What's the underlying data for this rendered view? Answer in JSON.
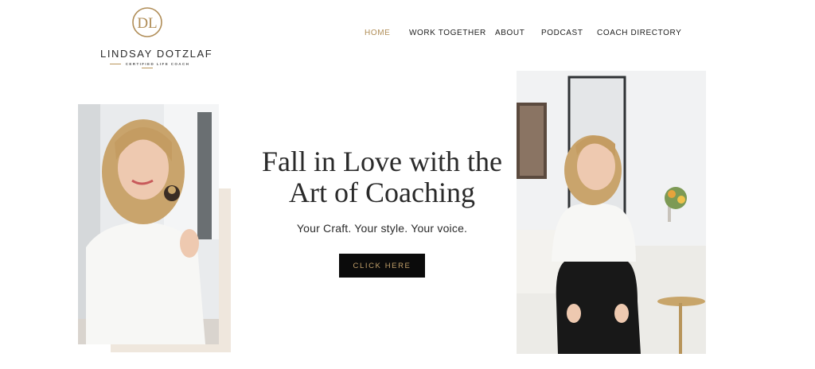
{
  "logo": {
    "monogram": "DL",
    "name": "LINDSAY DOTZLAF",
    "tagline": "CERTIFIED LIFE COACH",
    "accent_color": "#b08d57"
  },
  "nav": {
    "items": [
      {
        "label": "HOME",
        "active": true
      },
      {
        "label": "WORK TOGETHER",
        "active": false
      },
      {
        "label": "ABOUT",
        "active": false
      },
      {
        "label": "PODCAST",
        "active": false
      },
      {
        "label": "COACH DIRECTORY",
        "active": false
      }
    ]
  },
  "hero": {
    "title_line1": "Fall in Love with the",
    "title_line2": "Art of Coaching",
    "subtitle": "Your Craft. Your style. Your voice.",
    "cta_label": "CLICK HERE"
  },
  "colors": {
    "gold": "#b08d57",
    "button_bg": "#0b0b0b",
    "beige_block": "#efe7dd"
  }
}
